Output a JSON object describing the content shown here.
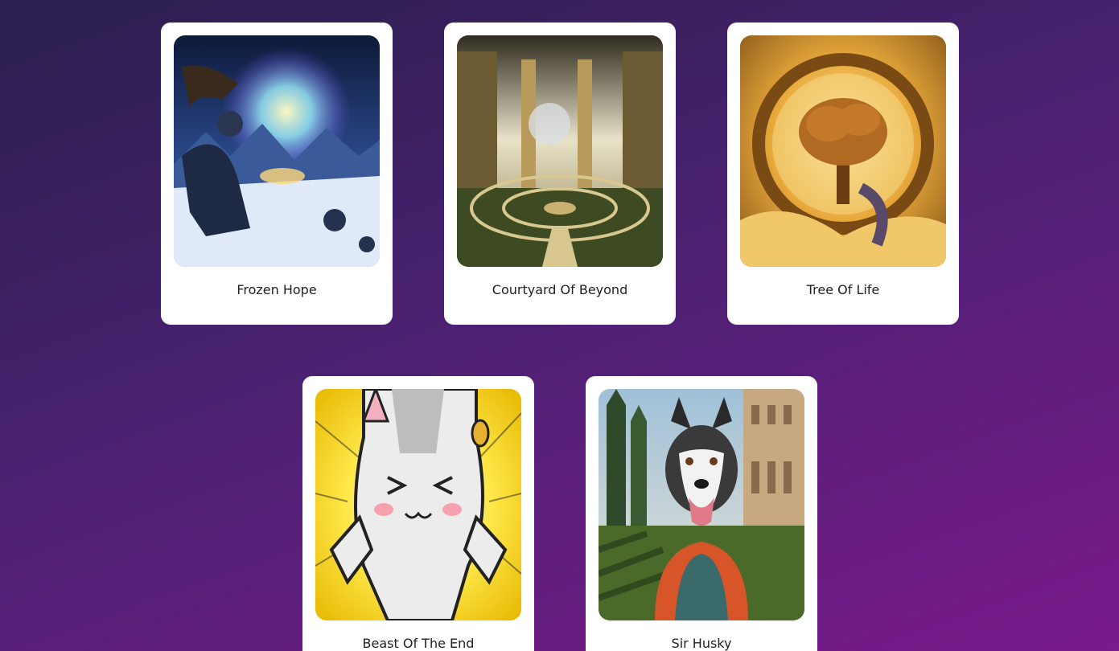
{
  "gallery": {
    "cards": [
      {
        "title": "Frozen Hope",
        "image": "frozen-hope-artwork"
      },
      {
        "title": "Courtyard Of Beyond",
        "image": "courtyard-of-beyond-artwork"
      },
      {
        "title": "Tree Of Life",
        "image": "tree-of-life-artwork"
      },
      {
        "title": "Beast Of The End",
        "image": "beast-of-the-end-artwork"
      },
      {
        "title": "Sir Husky",
        "image": "sir-husky-artwork"
      }
    ]
  },
  "colors": {
    "background_start": "#2a1f4e",
    "background_end": "#7a1a8c",
    "card": "#ffffff",
    "text": "#222222"
  }
}
